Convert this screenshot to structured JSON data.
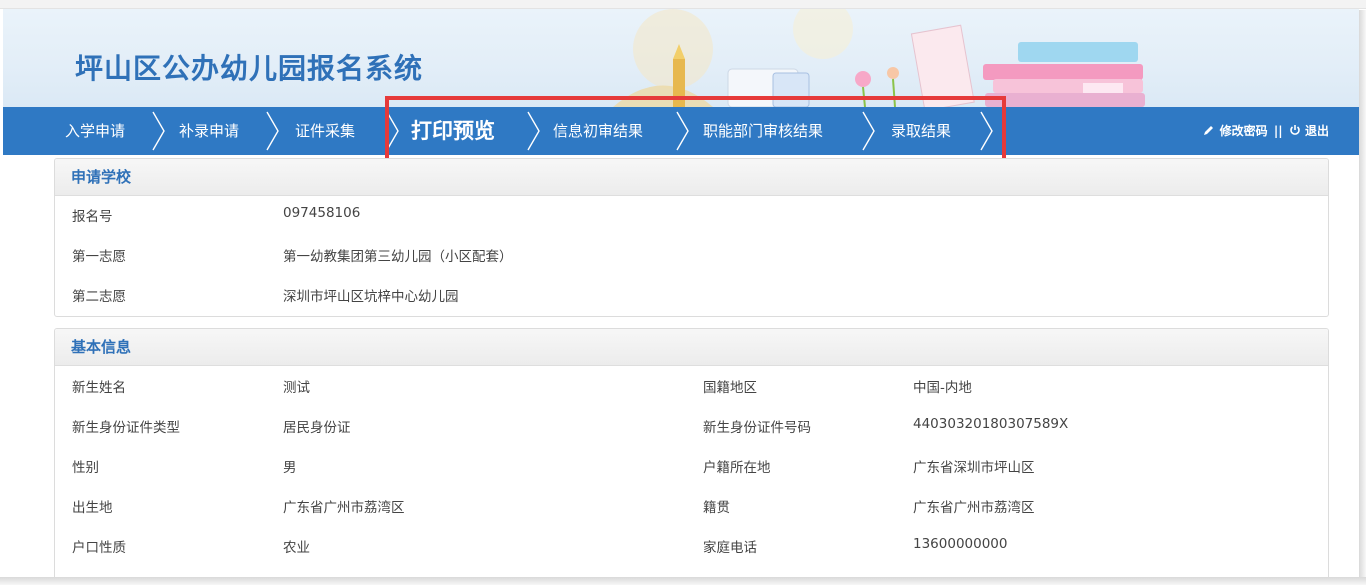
{
  "app": {
    "title": "坪山区公办幼儿园报名系统"
  },
  "nav": {
    "items": [
      {
        "label": "入学申请"
      },
      {
        "label": "补录申请"
      },
      {
        "label": "证件采集"
      },
      {
        "label": "打印预览",
        "active": true
      },
      {
        "label": "信息初审结果"
      },
      {
        "label": "职能部门审核结果"
      },
      {
        "label": "录取结果"
      }
    ],
    "change_password": "修改密码",
    "separator": "||",
    "logout": "退出"
  },
  "colors": {
    "nav_bar": "#2f79c4",
    "title": "#2f71b8",
    "highlight_box": "#e63a3a"
  },
  "icons": {
    "edit": "pencil-icon",
    "logout": "power-icon"
  },
  "school": {
    "title": "申请学校",
    "fields": [
      {
        "label": "报名号",
        "value": "097458106"
      },
      {
        "label": "第一志愿",
        "value": "第一幼教集团第三幼儿园（小区配套）"
      },
      {
        "label": "第二志愿",
        "value": "深圳市坪山区坑梓中心幼儿园"
      }
    ]
  },
  "basic": {
    "title": "基本信息",
    "left": [
      {
        "label": "新生姓名",
        "value": "测试"
      },
      {
        "label": "新生身份证件类型",
        "value": "居民身份证"
      },
      {
        "label": "性别",
        "value": "男"
      },
      {
        "label": "出生地",
        "value": "广东省广州市荔湾区"
      },
      {
        "label": "户口性质",
        "value": "农业"
      }
    ],
    "right": [
      {
        "label": "国籍地区",
        "value": "中国-内地"
      },
      {
        "label": "新生身份证件号码",
        "value": "44030320180307589X"
      },
      {
        "label": "户籍所在地",
        "value": "广东省深圳市坪山区"
      },
      {
        "label": "籍贯",
        "value": "广东省广州市荔湾区"
      },
      {
        "label": "家庭电话",
        "value": "13600000000"
      }
    ]
  }
}
